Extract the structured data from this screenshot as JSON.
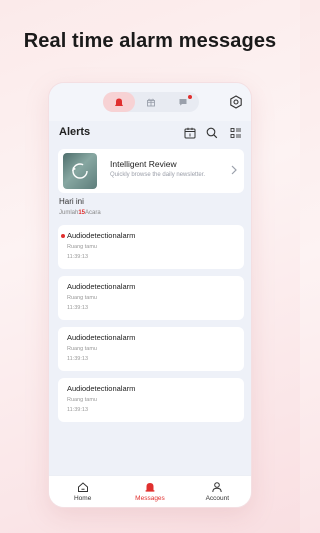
{
  "headline": "Real time alarm messages",
  "colors": {
    "accent": "#e0302f",
    "screen_bg": "#eef1f8",
    "seg_active": "#f7d2d4"
  },
  "topbar": {
    "segments": [
      {
        "icon": "alarm-bell-icon",
        "active": true
      },
      {
        "icon": "gift-icon",
        "active": false
      },
      {
        "icon": "chat-bubble-icon",
        "active": false,
        "badge": true
      }
    ],
    "settings_icon": "gear-icon"
  },
  "header": {
    "title": "Alerts",
    "icons": [
      "calendar-icon",
      "search-icon",
      "filter-list-icon"
    ]
  },
  "review": {
    "title": "Intelligent Review",
    "subtitle": "Quickly browse the daily newsletter."
  },
  "section": {
    "today_label": "Hari ini",
    "count_prefix": "Jumlah",
    "count_value": "15",
    "count_suffix": "Acara"
  },
  "alerts": [
    {
      "title": "Audiodetectionalarm",
      "location": "Ruang tamu",
      "time": "11:39:13",
      "unread": true
    },
    {
      "title": "Audiodetectionalarm",
      "location": "Ruang tamu",
      "time": "11:39:13",
      "unread": false
    },
    {
      "title": "Audiodetectionalarm",
      "location": "Ruang tamu",
      "time": "11:39:13",
      "unread": false
    },
    {
      "title": "Audiodetectionalarm",
      "location": "Ruang tamu",
      "time": "11:39:13",
      "unread": false
    }
  ],
  "tabbar": {
    "tabs": [
      {
        "label": "Home",
        "icon": "home-icon",
        "active": false
      },
      {
        "label": "Messages",
        "icon": "alarm-bell-icon",
        "active": true
      },
      {
        "label": "Account",
        "icon": "person-icon",
        "active": false
      }
    ]
  }
}
